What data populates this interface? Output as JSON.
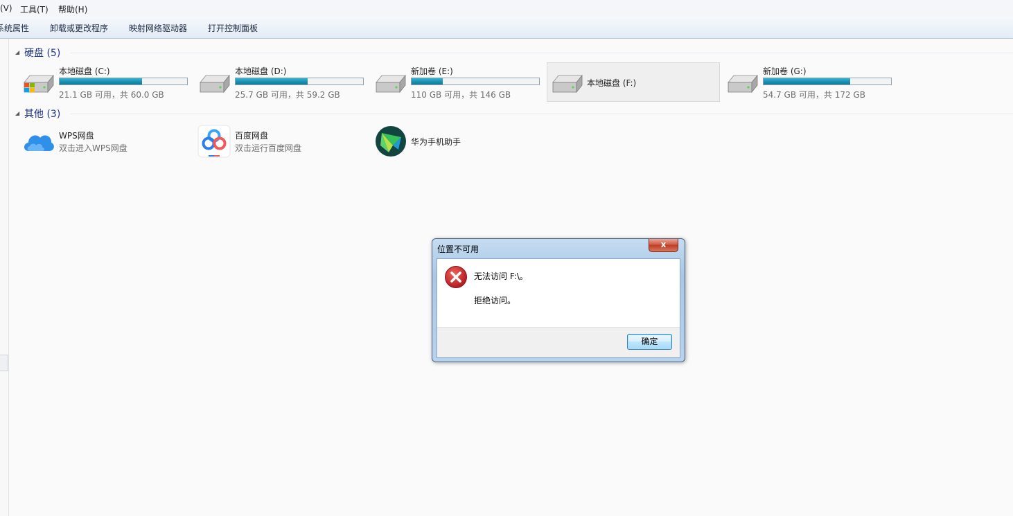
{
  "menubar": {
    "view": "(V)",
    "tools": "工具(T)",
    "help": "帮助(H)"
  },
  "toolbar": {
    "system_properties": "系统属性",
    "uninstall": "卸载或更改程序",
    "map_drive": "映射网络驱动器",
    "control_panel": "打开控制面板"
  },
  "groups": {
    "hard_disks": {
      "title": "硬盘 (5)"
    },
    "other": {
      "title": "其他 (3)"
    }
  },
  "drives": [
    {
      "name": "本地磁盘 (C:)",
      "free_text": "21.1 GB 可用，共 60.0 GB",
      "used_fraction": 0.648
    },
    {
      "name": "本地磁盘 (D:)",
      "free_text": "25.7 GB 可用，共 59.2 GB",
      "used_fraction": 0.566
    },
    {
      "name": "新加卷 (E:)",
      "free_text": "110 GB 可用，共 146 GB",
      "used_fraction": 0.247
    },
    {
      "name": "本地磁盘 (F:)",
      "free_text": "",
      "used_fraction": null
    },
    {
      "name": "新加卷 (G:)",
      "free_text": "54.7 GB 可用，共 172 GB",
      "used_fraction": 0.682
    }
  ],
  "other_items": [
    {
      "title": "WPS网盘",
      "subtitle": "双击进入WPS网盘",
      "icon": "wps-cloud-icon"
    },
    {
      "title": "百度网盘",
      "subtitle": "双击运行百度网盘",
      "icon": "baidu-netdisk-icon"
    },
    {
      "title": "华为手机助手",
      "subtitle": "",
      "icon": "huawei-hisuite-icon"
    }
  ],
  "dialog": {
    "title": "位置不可用",
    "close_label": "x",
    "message_line1": "无法访问 F:\\。",
    "message_line2": "拒绝访问。",
    "ok_label": "确定",
    "icon": "error-icon"
  },
  "colors": {
    "accent_bar": "#1d8fb0",
    "group_title": "#1e3287",
    "error_red": "#c0262d"
  }
}
